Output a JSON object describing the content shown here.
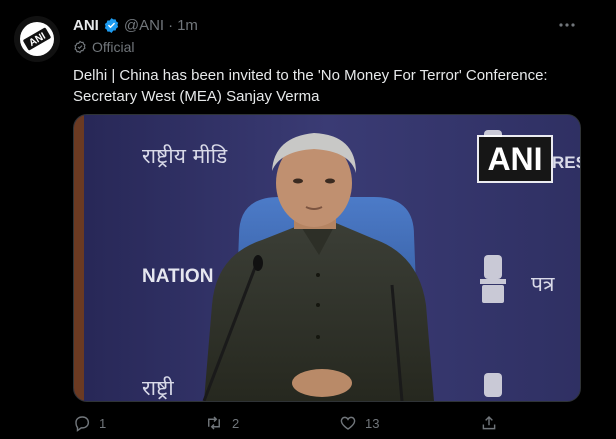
{
  "author": {
    "name": "ANI",
    "handle": "@ANI",
    "time": "1m",
    "label": "Official",
    "avatar_text": "ANI"
  },
  "tweet": {
    "text_line1": "Delhi | China has been invited to the 'No Money For Terror' Conference:",
    "text_line2": "Secretary West (MEA) Sanjay Verma"
  },
  "media": {
    "watermark": "ANI",
    "backdrop_hindi_top": "राष्ट्रीय मीडि",
    "backdrop_national": "NATION",
    "backdrop_hindi_bottom": "राष्ट्री",
    "backdrop_patra": "पत्र",
    "backdrop_press": "RES"
  },
  "actions": {
    "replies": "1",
    "retweets": "2",
    "likes": "13"
  },
  "colors": {
    "background": "#000000",
    "text": "#e7e9ea",
    "muted": "#71767b",
    "verified": "#1d9bf0",
    "media_backdrop": "#2a2b5a"
  }
}
